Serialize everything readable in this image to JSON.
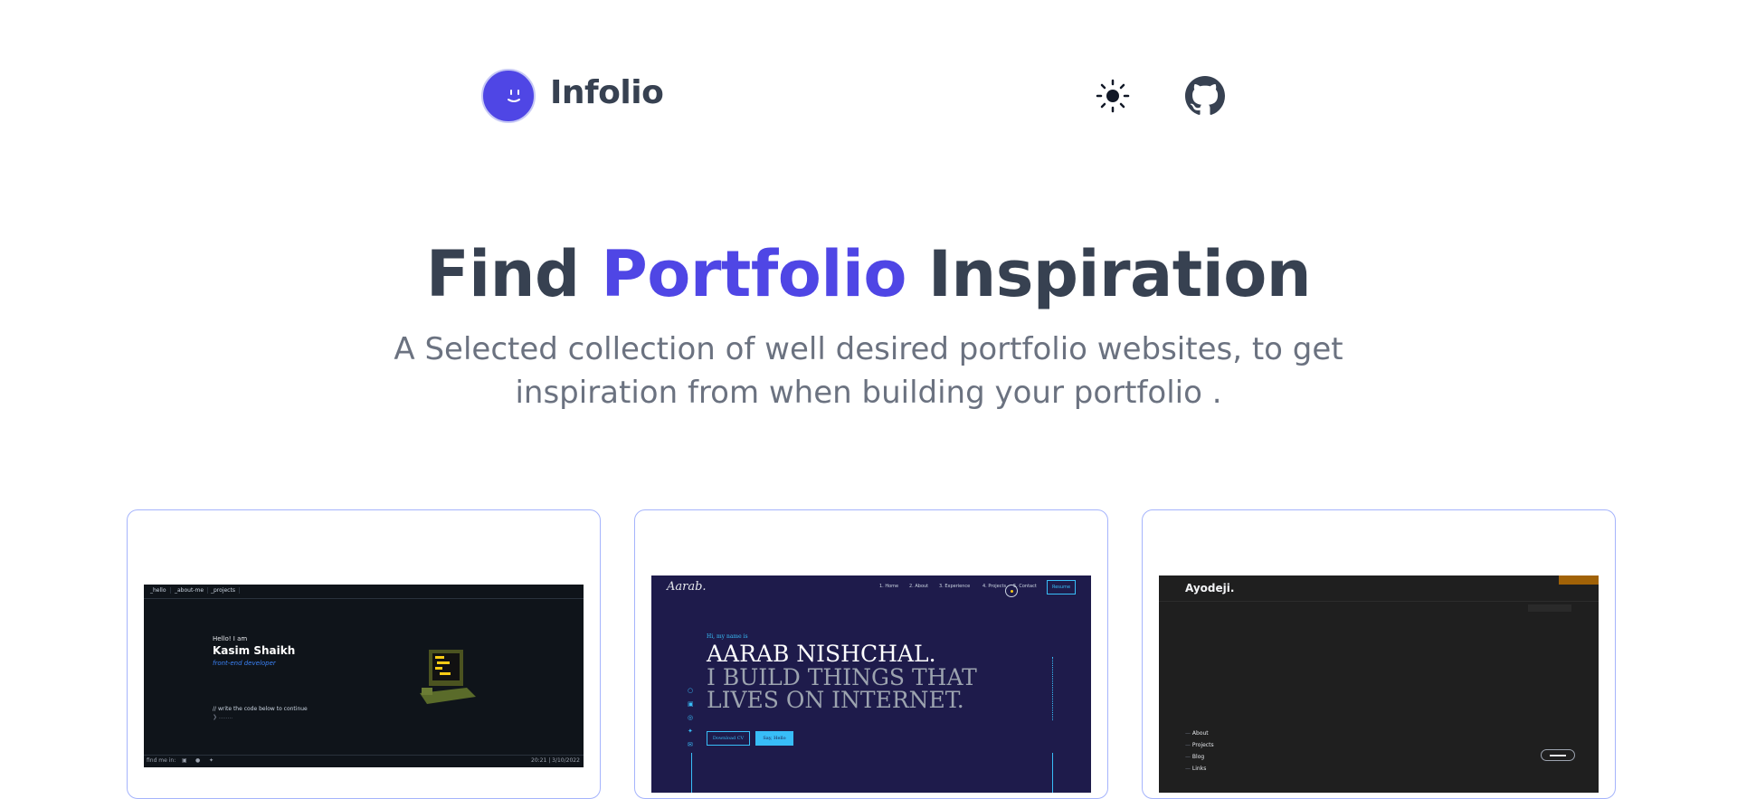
{
  "brand": {
    "name": "Infolio"
  },
  "header": {
    "theme_icon": "sun-icon",
    "github_icon": "github-icon"
  },
  "hero": {
    "title_part1": "Find",
    "title_accent": "Portfolio",
    "title_part2": "Inspiration",
    "subtitle_line1": "A Selected collection of well desired portfolio websites, to get",
    "subtitle_line2": "inspiration from when building your portfolio ."
  },
  "colors": {
    "accent": "#4f46e5",
    "text": "#374151",
    "muted": "#6b7280",
    "card_border": "#a5b4fc"
  },
  "cards": [
    {
      "tabs": [
        "_hello",
        "_about-me",
        "_projects"
      ],
      "greeting": "Hello! I am",
      "name": "Kasim Shaikh",
      "role": "front-end developer",
      "prompt": "// write the code below to continue",
      "footer_left": "find me in:",
      "footer_right": "20:21 | 3/10/2022"
    },
    {
      "logo": "Aarab.",
      "nav": [
        "1. Home",
        "2. About",
        "3. Experience",
        "4. Projects",
        "5. Contact"
      ],
      "resume": "Resume",
      "intro": "Hi, my name is",
      "headline1": "AARAB NISHCHAL.",
      "headline2": "I BUILD THINGS THAT",
      "headline3": "LIVES ON INTERNET.",
      "btn1": "Download CV",
      "btn2": "Say, Hello"
    },
    {
      "logo": "Ayodeji.",
      "nav": [
        "About",
        "Projects",
        "Blog",
        "Links"
      ]
    }
  ]
}
